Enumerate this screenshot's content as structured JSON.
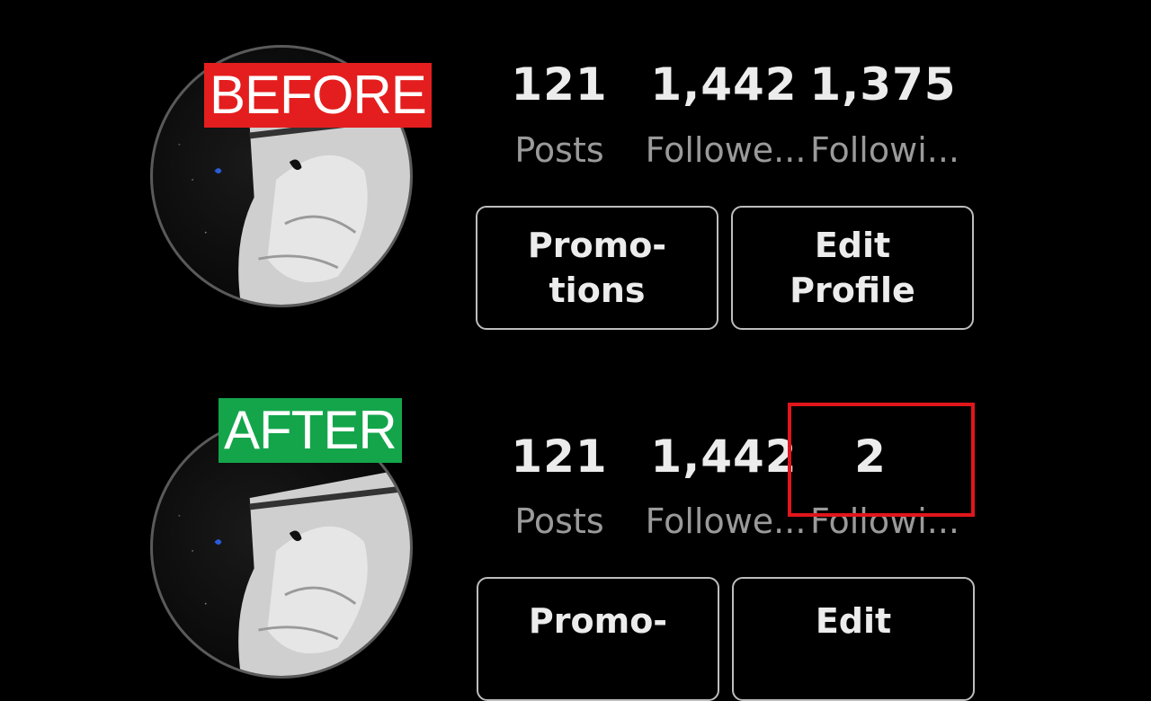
{
  "before": {
    "tag": "BEFORE",
    "stats": [
      {
        "value": "121",
        "label": "Posts"
      },
      {
        "value": "1,442",
        "label": "Followe..."
      },
      {
        "value": "1,375",
        "label": "Followi..."
      }
    ],
    "buttons": {
      "promotions": [
        "Promo-",
        "tions"
      ],
      "edit_profile": [
        "Edit",
        "Profile"
      ]
    }
  },
  "after": {
    "tag": "AFTER",
    "stats": [
      {
        "value": "121",
        "label": "Posts"
      },
      {
        "value": "1,442",
        "label": "Followe..."
      },
      {
        "value": "2",
        "label": "Followi..."
      }
    ],
    "buttons": {
      "promotions": [
        "Promo-"
      ],
      "edit_profile": [
        "Edit"
      ]
    }
  },
  "colors": {
    "before_tag": "#e41e1e",
    "after_tag": "#14a54b",
    "highlight": "#e0161c"
  }
}
